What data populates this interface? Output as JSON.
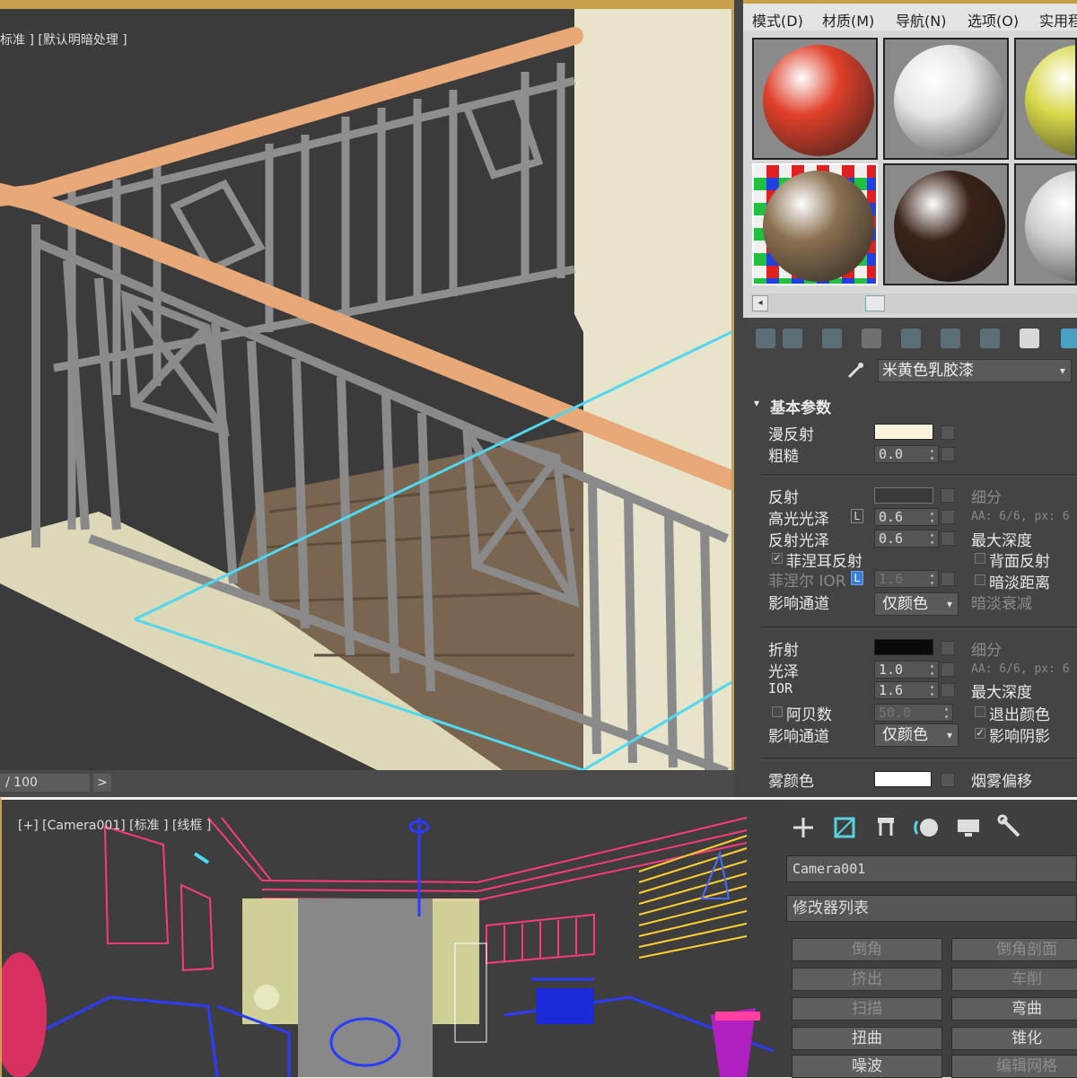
{
  "viewport_top": {
    "label": "标准 ] [默认明暗处理 ]"
  },
  "timeline": {
    "frame_text": "/ 100",
    "next_arrow": ">"
  },
  "material_editor": {
    "menu": [
      "模式(D)",
      "材质(M)",
      "导航(N)",
      "选项(O)",
      "实用程"
    ],
    "swatches": [
      {
        "name": "red-sphere",
        "color": "#e0402a"
      },
      {
        "name": "white-sphere",
        "color": "#e6e6e6"
      },
      {
        "name": "yellow-blue-sphere",
        "color": "#d8d84a"
      },
      {
        "name": "wood-sphere",
        "color": "#8a7050"
      },
      {
        "name": "dark-wood-sphere",
        "color": "#3a2218"
      },
      {
        "name": "grey-sphere",
        "color": "#cfcfcf"
      }
    ],
    "scroll_left": "◂",
    "material_name": "米黄色乳胶漆",
    "dropdown_arrow": "▾",
    "section_title": "基本参数",
    "section_arrow": "▾",
    "basic": {
      "diffuse_label": "漫反射",
      "diffuse_color": "#f7f3dc",
      "roughness_label": "粗糙",
      "roughness_value": "0.0"
    },
    "reflection": {
      "label": "反射",
      "color": "#3a3a3a",
      "subdivs_label": "细分",
      "hilight_label": "高光光泽",
      "hilight_lock": "L",
      "hilight_value": "0.6",
      "aa_text": "AA: 6/6, px: 6",
      "refl_gloss_label": "反射光泽",
      "refl_gloss_value": "0.6",
      "max_depth_label": "最大深度",
      "fresnel_label": "菲涅耳反射",
      "fresnel_check": "✓",
      "back_side_label": "背面反射",
      "fresnel_ior_label": "菲涅尔 IOR",
      "fresnel_ior_lock": "L",
      "fresnel_ior_value": "1.6",
      "dim_distance_label": "暗淡距离",
      "affect_channels_label": "影响通道",
      "affect_channels_value": "仅颜色",
      "dim_falloff_label": "暗淡衰减"
    },
    "refraction": {
      "label": "折射",
      "color": "#0a0a0a",
      "subdivs_label": "细分",
      "gloss_label": "光泽",
      "gloss_value": "1.0",
      "aa_text": "AA: 6/6, px: 6",
      "ior_label": "IOR",
      "ior_value": "1.6",
      "max_depth_label": "最大深度",
      "abbe_label": "阿贝数",
      "abbe_value": "50.0",
      "exit_color_label": "退出颜色",
      "affect_channels_label": "影响通道",
      "affect_channels_value": "仅颜色",
      "affect_shadows_label": "影响阴影",
      "affect_shadows_check": "✓"
    },
    "fog": {
      "label": "雾颜色",
      "color": "#ffffff",
      "bias_label": "烟雾偏移"
    }
  },
  "viewport_bottom": {
    "label": "[+] [Camera001] [标准 ] [线框 ]"
  },
  "command_panel": {
    "object_name": "Camera001",
    "modifier_list": "修改器列表",
    "buttons": [
      {
        "label": "倒角",
        "enabled": false
      },
      {
        "label": "倒角剖面",
        "enabled": false
      },
      {
        "label": "挤出",
        "enabled": false
      },
      {
        "label": "车削",
        "enabled": false
      },
      {
        "label": "扫描",
        "enabled": false
      },
      {
        "label": "弯曲",
        "enabled": true
      },
      {
        "label": "扭曲",
        "enabled": true
      },
      {
        "label": "锥化",
        "enabled": true
      },
      {
        "label": "噪波",
        "enabled": true
      },
      {
        "label": "编辑网格",
        "enabled": false
      }
    ]
  }
}
